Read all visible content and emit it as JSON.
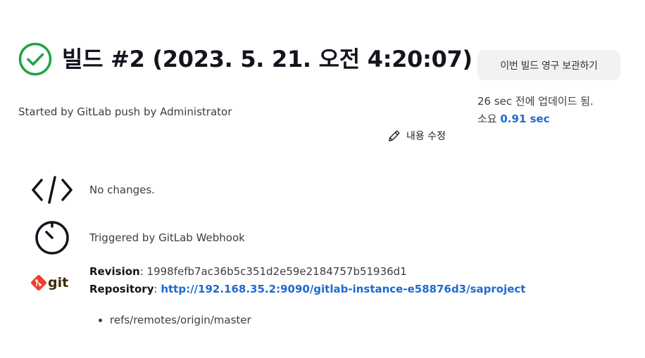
{
  "build": {
    "title": "빌드 #2 (2023. 5. 21. 오전 4:20:07)",
    "status_icon": "success-check-circle-icon",
    "status_color": "#1ea446",
    "started_by": "Started by GitLab push by Administrator",
    "keep_button_label": "이번 빌드 영구 보관하기",
    "updated_text": "26 sec 전에 업데이드 됨.",
    "duration_label": "소요",
    "duration_value": "0.91 sec",
    "edit_description_label": "내용 수정"
  },
  "changes": {
    "icon": "code-icon",
    "text": "No changes."
  },
  "trigger": {
    "icon": "timer-icon",
    "text": "Triggered by GitLab Webhook"
  },
  "git": {
    "logo": "git-logo",
    "logo_color": "#f03c2e",
    "revision_label": "Revision",
    "revision_value": "1998fefb7ac36b5c351d2e59e2184757b51936d1",
    "repository_label": "Repository",
    "repository_url": "http://192.168.35.2:9090/gitlab-instance-e58876d3/saproject",
    "branches": [
      "refs/remotes/origin/master"
    ]
  },
  "colors": {
    "link": "#1d6ad1",
    "button_bg": "#f2f2f4"
  }
}
